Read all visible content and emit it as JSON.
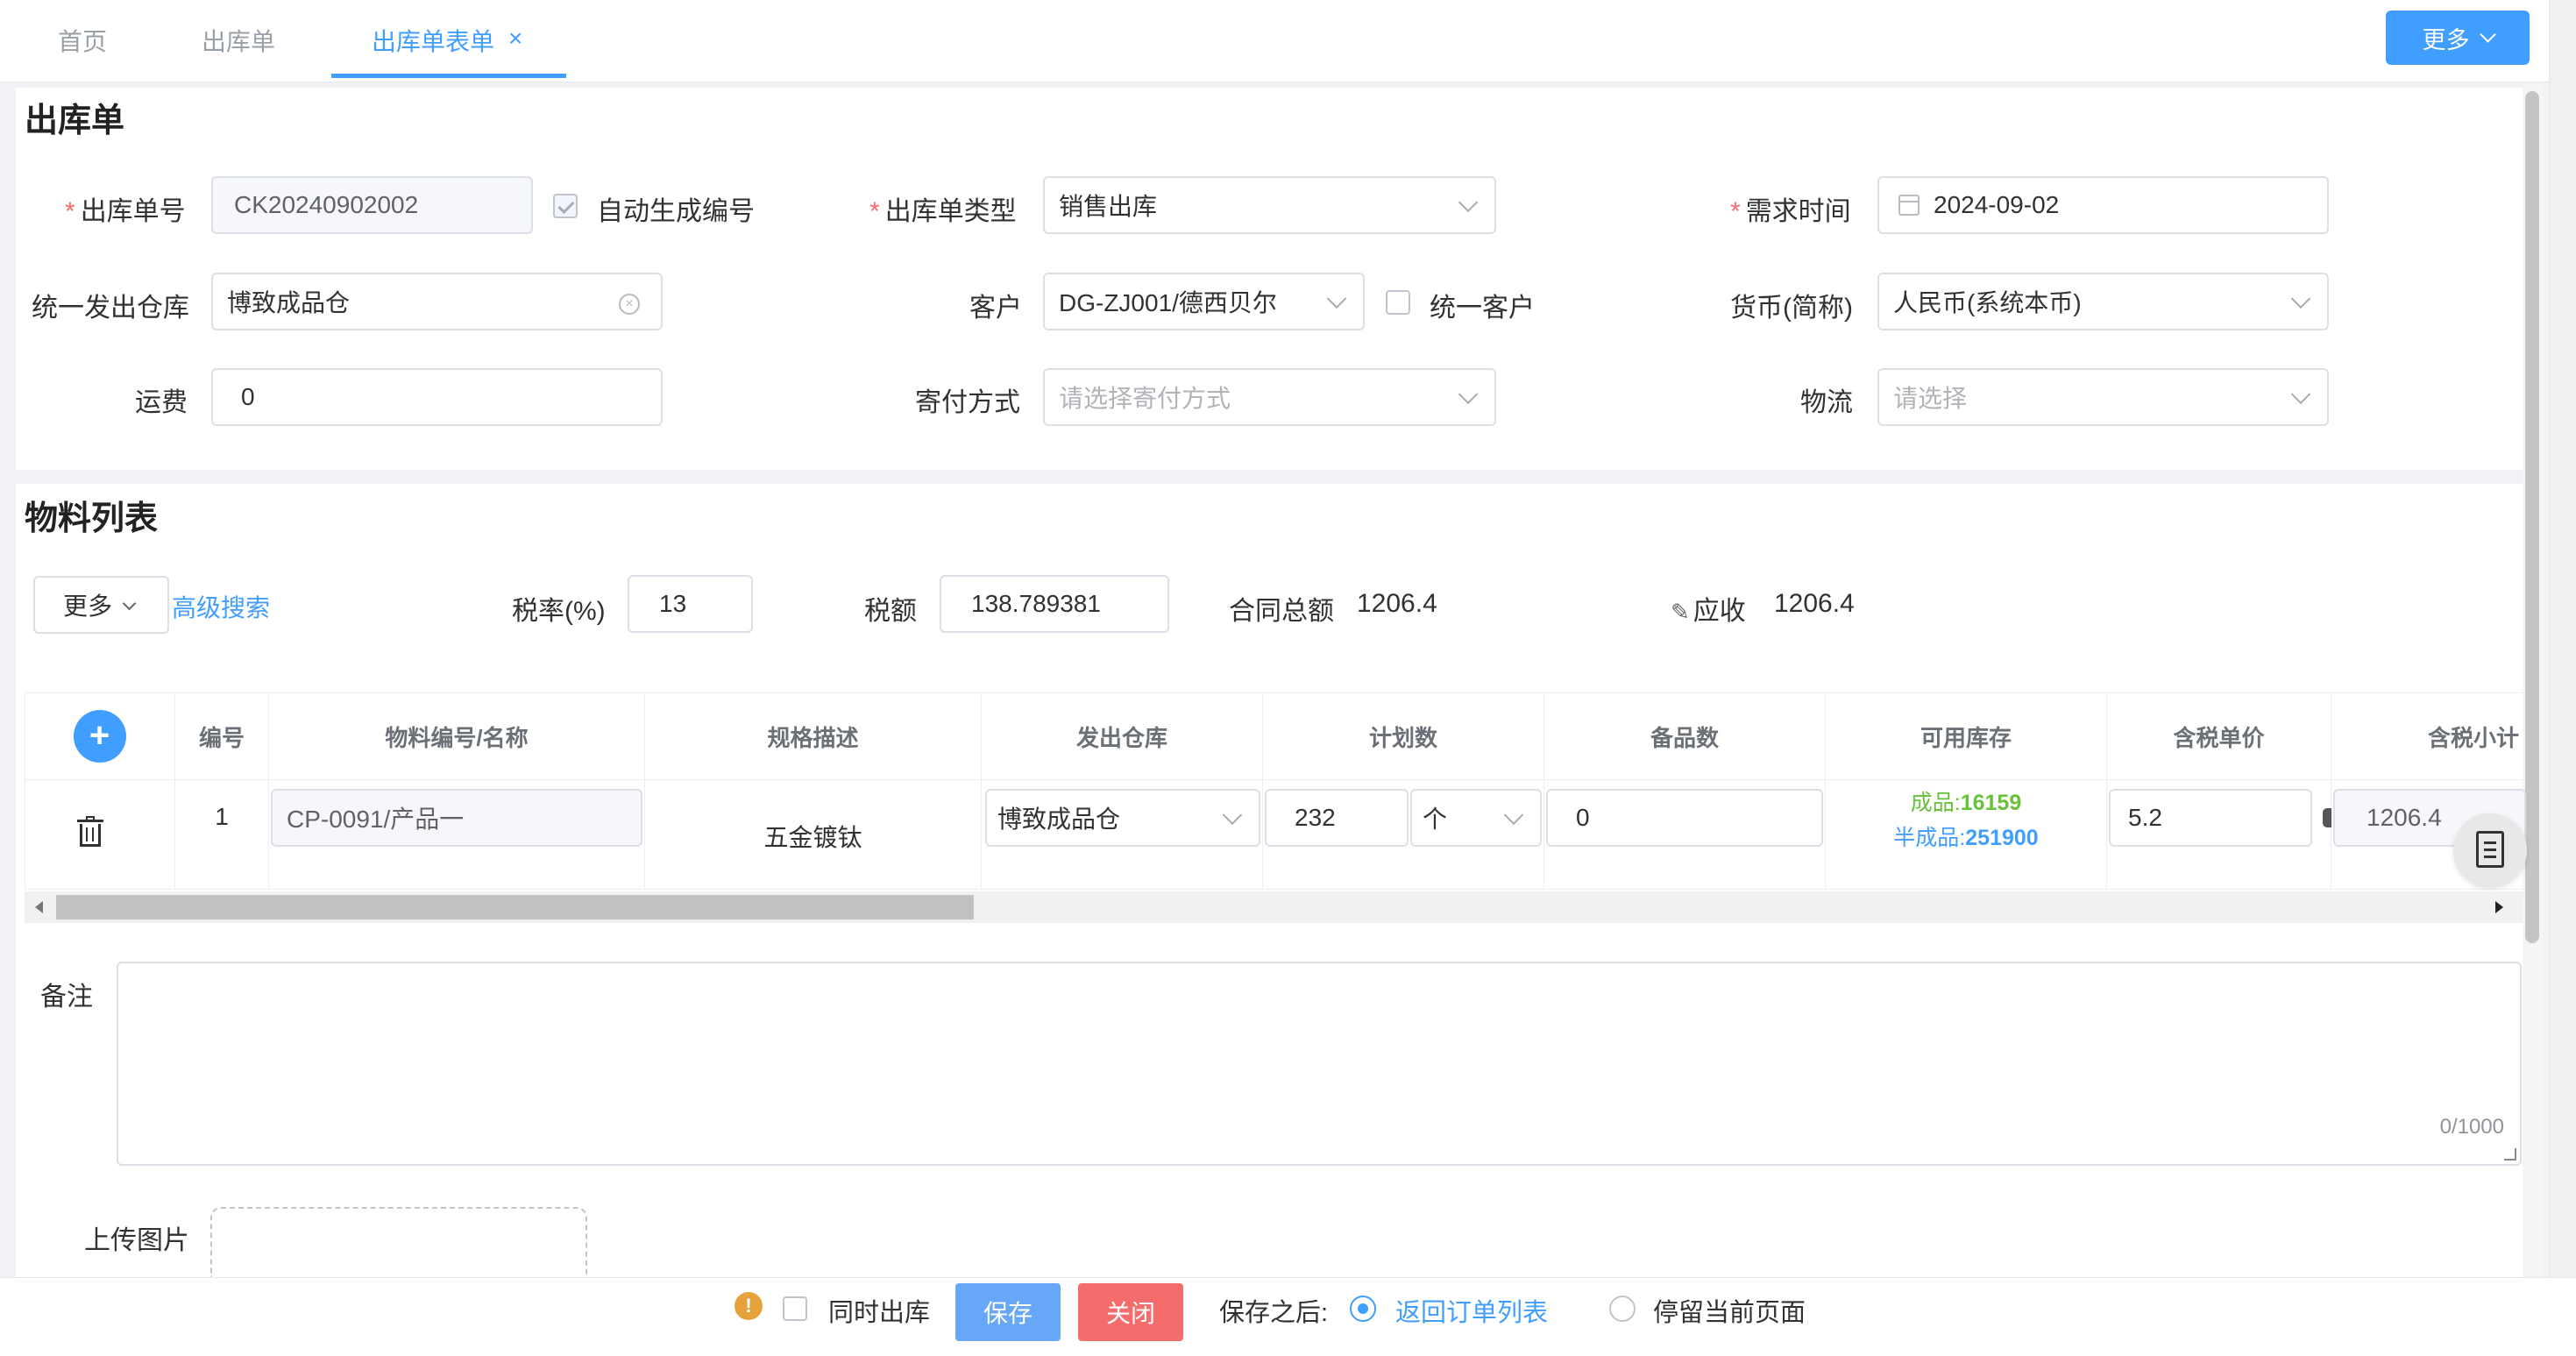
{
  "tabs": {
    "home": "首页",
    "list": "出库单",
    "form": "出库单表单",
    "close": "×"
  },
  "top_more": {
    "label": "更多"
  },
  "header": {
    "title": "出库单"
  },
  "form": {
    "order_no_label": "出库单号",
    "order_no_value": "CK20240902002",
    "auto_gen_label": "自动生成编号",
    "type_label": "出库单类型",
    "type_value": "销售出库",
    "date_label": "需求时间",
    "date_value": "2024-09-02",
    "warehouse_label": "统一发出仓库",
    "warehouse_value": "博致成品仓",
    "customer_label": "客户",
    "customer_value": "DG-ZJ001/德西贝尔",
    "unify_customer_label": "统一客户",
    "currency_label": "货币(简称)",
    "currency_value": "人民币(系统本币)",
    "freight_label": "运费",
    "freight_value": "0",
    "shipping_label": "寄付方式",
    "shipping_placeholder": "请选择寄付方式",
    "logistics_label": "物流",
    "logistics_placeholder": "请选择"
  },
  "materials": {
    "title": "物料列表",
    "more_label": "更多",
    "adv_search": "高级搜索",
    "tax_rate_label": "税率(%)",
    "tax_rate_value": "13",
    "tax_label": "税额",
    "tax_value": "138.789381",
    "contract_label": "合同总额",
    "contract_value": "1206.4",
    "receivable_label": "应收",
    "receivable_value": "1206.4"
  },
  "table": {
    "columns": [
      "编号",
      "物料编号/名称",
      "规格描述",
      "发出仓库",
      "计划数",
      "备品数",
      "可用库存",
      "含税单价",
      "含税小计"
    ],
    "row": {
      "index": "1",
      "material": "CP-0091/产品一",
      "spec": "五金镀钛",
      "warehouse": "博致成品仓",
      "plan_qty": "232",
      "unit": "个",
      "spare_qty": "0",
      "stock_finished_label": "成品:",
      "stock_finished_value": "16159",
      "stock_semi_label": "半成品:",
      "stock_semi_value": "251900",
      "unit_price": "5.2",
      "subtotal": "1206.4"
    }
  },
  "remark": {
    "label": "备注",
    "counter": "0/1000"
  },
  "upload": {
    "label": "上传图片"
  },
  "footer": {
    "sync_label": "同时出库",
    "save": "保存",
    "close": "关闭",
    "after_save": "保存之后:",
    "return_list": "返回订单列表",
    "stay": "停留当前页面"
  },
  "colors": {
    "primary": "#409eff",
    "danger": "#f56c6c",
    "success": "#67c23a",
    "warning": "#e6a23c"
  }
}
